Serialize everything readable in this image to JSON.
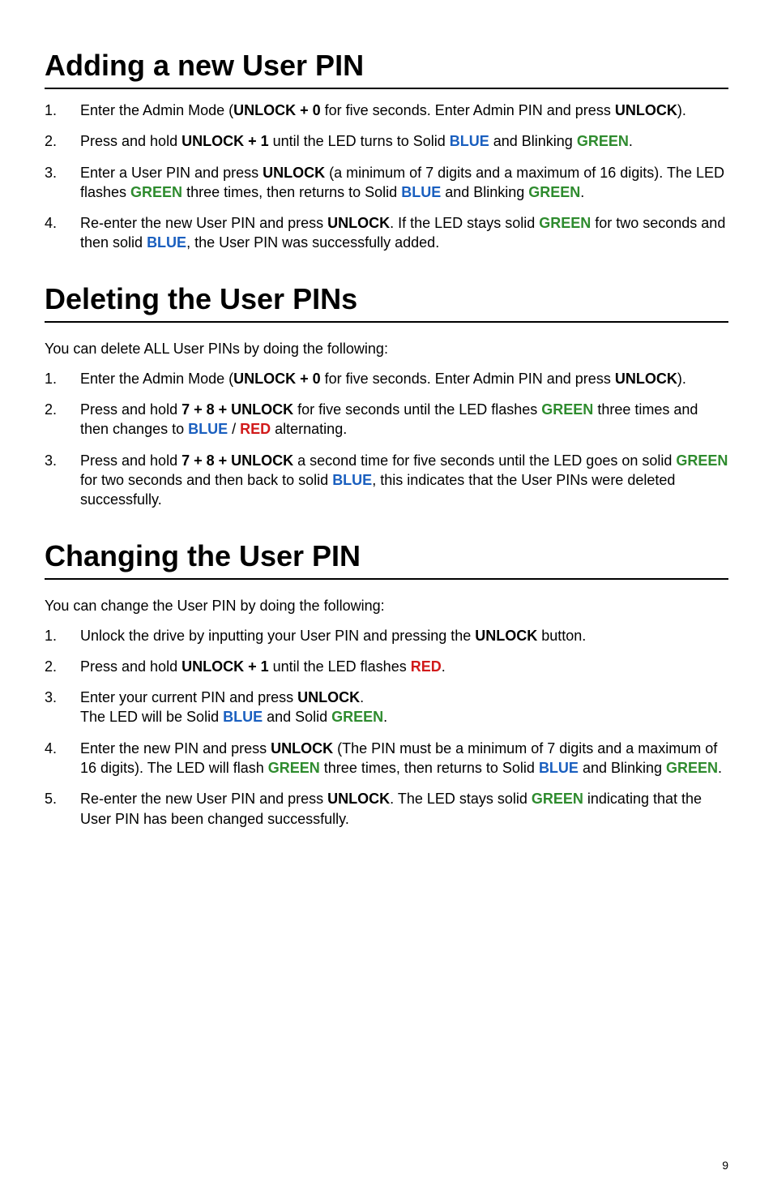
{
  "sections": [
    {
      "title": "Adding a new User PIN",
      "lead": "",
      "steps": [
        [
          {
            "t": "Enter the Admin Mode ("
          },
          {
            "t": "UNLOCK + 0",
            "cls": "b"
          },
          {
            "t": " for five seconds. Enter Admin PIN and press "
          },
          {
            "t": "UNLOCK",
            "cls": "b"
          },
          {
            "t": ")."
          }
        ],
        [
          {
            "t": "Press and hold "
          },
          {
            "t": "UNLOCK + 1",
            "cls": "b"
          },
          {
            "t": " until the LED turns to Solid "
          },
          {
            "t": "BLUE",
            "cls": "blue"
          },
          {
            "t": " and Blinking "
          },
          {
            "t": "GREEN",
            "cls": "green"
          },
          {
            "t": "."
          }
        ],
        [
          {
            "t": "Enter a User PIN and press "
          },
          {
            "t": "UNLOCK",
            "cls": "b"
          },
          {
            "t": " (a minimum of 7 digits and a maximum of 16 digits). The LED flashes "
          },
          {
            "t": "GREEN",
            "cls": "green"
          },
          {
            "t": " three times, then returns to Solid "
          },
          {
            "t": "BLUE",
            "cls": "blue"
          },
          {
            "t": " and Blinking "
          },
          {
            "t": "GREEN",
            "cls": "green"
          },
          {
            "t": "."
          }
        ],
        [
          {
            "t": "Re-enter the new User PIN and press "
          },
          {
            "t": "UNLOCK",
            "cls": "b"
          },
          {
            "t": ". If the LED stays solid "
          },
          {
            "t": "GREEN",
            "cls": "green"
          },
          {
            "t": " for two seconds and then solid "
          },
          {
            "t": "BLUE",
            "cls": "blue"
          },
          {
            "t": ", the User PIN was successfully added."
          }
        ]
      ]
    },
    {
      "title": "Deleting the User PINs",
      "lead": "You can delete ALL User PINs by doing the following:",
      "steps": [
        [
          {
            "t": "Enter the Admin Mode ("
          },
          {
            "t": "UNLOCK + 0",
            "cls": "b"
          },
          {
            "t": " for five seconds. Enter Admin PIN and press "
          },
          {
            "t": "UNLOCK",
            "cls": "b"
          },
          {
            "t": ")."
          }
        ],
        [
          {
            "t": "Press and hold "
          },
          {
            "t": "7 + 8 + UNLOCK",
            "cls": "b"
          },
          {
            "t": " for five seconds until the LED flashes "
          },
          {
            "t": "GREEN",
            "cls": "green"
          },
          {
            "t": " three times and then changes to "
          },
          {
            "t": "BLUE",
            "cls": "blue"
          },
          {
            "t": " / "
          },
          {
            "t": "RED",
            "cls": "red"
          },
          {
            "t": " alternating."
          }
        ],
        [
          {
            "t": "Press and hold "
          },
          {
            "t": "7 + 8 + UNLOCK",
            "cls": "b"
          },
          {
            "t": "  a second time for five seconds until the LED goes on solid "
          },
          {
            "t": "GREEN",
            "cls": "green"
          },
          {
            "t": " for two seconds and then back to solid "
          },
          {
            "t": "BLUE",
            "cls": "blue"
          },
          {
            "t": ", this indicates that the User PINs were deleted successfully."
          }
        ]
      ]
    },
    {
      "title": "Changing the User PIN",
      "lead": "You can change the User PIN by doing the following:",
      "steps": [
        [
          {
            "t": "Unlock the drive by inputting your User PIN and pressing the "
          },
          {
            "t": "UNLOCK",
            "cls": "b"
          },
          {
            "t": " button."
          }
        ],
        [
          {
            "t": "Press and hold "
          },
          {
            "t": "UNLOCK + 1",
            "cls": "b"
          },
          {
            "t": " until the LED flashes "
          },
          {
            "t": "RED",
            "cls": "red"
          },
          {
            "t": "."
          }
        ],
        [
          {
            "t": "Enter your current PIN and press "
          },
          {
            "t": "UNLOCK",
            "cls": "b"
          },
          {
            "t": "."
          },
          {
            "t": "\n"
          },
          {
            "t": "The LED will be Solid "
          },
          {
            "t": "BLUE",
            "cls": "blue"
          },
          {
            "t": " and Solid "
          },
          {
            "t": "GREEN",
            "cls": "green"
          },
          {
            "t": "."
          }
        ],
        [
          {
            "t": "Enter the new PIN and press "
          },
          {
            "t": "UNLOCK",
            "cls": "b"
          },
          {
            "t": " (The PIN must be a minimum of 7 digits and a maximum of 16 digits). The LED will flash "
          },
          {
            "t": "GREEN",
            "cls": "green"
          },
          {
            "t": " three times, then returns to Solid "
          },
          {
            "t": "BLUE",
            "cls": "blue"
          },
          {
            "t": " and Blinking "
          },
          {
            "t": "GREEN",
            "cls": "green"
          },
          {
            "t": "."
          }
        ],
        [
          {
            "t": "Re-enter the new User PIN and press "
          },
          {
            "t": "UNLOCK",
            "cls": "b"
          },
          {
            "t": ". The LED stays solid "
          },
          {
            "t": "GREEN",
            "cls": "green"
          },
          {
            "t": " indicating that the User PIN has been changed successfully."
          }
        ]
      ]
    }
  ],
  "page_number": "9"
}
